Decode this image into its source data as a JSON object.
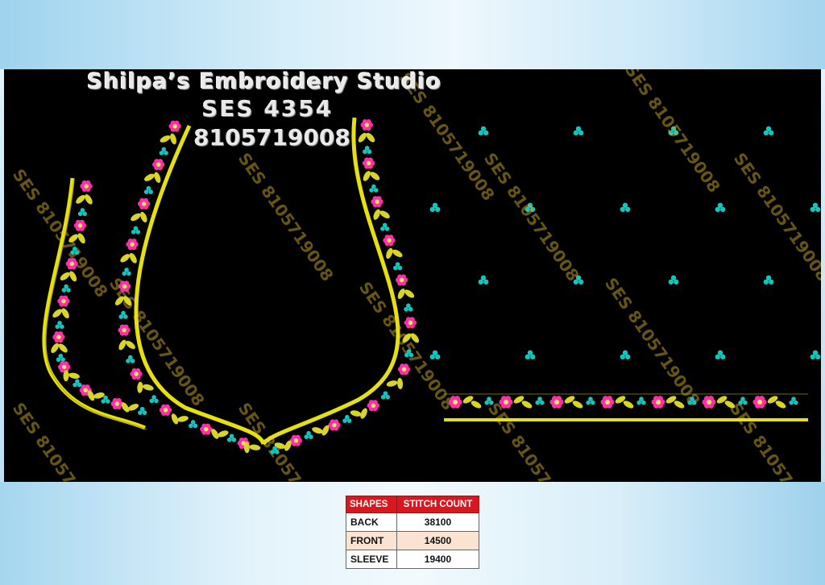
{
  "studio": {
    "name": "Shilpa’s Embroidery Studio",
    "design_code": "SES 4354",
    "phone": "8105719008"
  },
  "watermark_text": "SES 8105719008",
  "colors": {
    "background": "#000000",
    "thread_yellow": "#e6e10a",
    "thread_pink": "#ff2fa8",
    "thread_teal": "#12c6c0",
    "header_red": "#d8171f"
  },
  "stitch_table": {
    "headers": [
      "SHAPES",
      "STITCH COUNT"
    ],
    "rows": [
      {
        "shape": "BACK",
        "count": "38100"
      },
      {
        "shape": "FRONT",
        "count": "14500"
      },
      {
        "shape": "SLEEVE",
        "count": "19400"
      }
    ]
  }
}
